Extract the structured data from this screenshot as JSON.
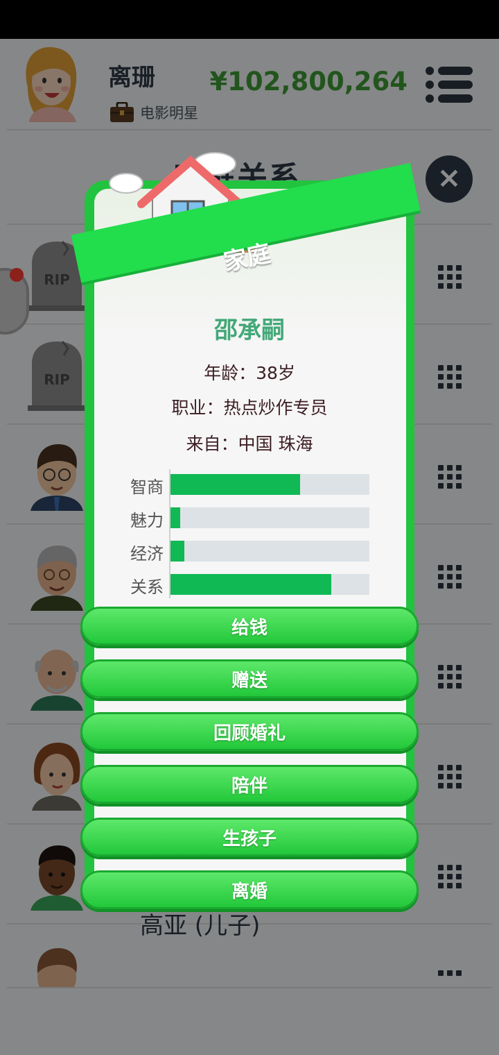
{
  "header": {
    "player_name": "离珊",
    "occupation": "电影明星",
    "money": "¥102,800,264"
  },
  "page": {
    "title": "家庭关系"
  },
  "relations": [
    {
      "type": "deceased",
      "tombstone_text": "RIP"
    },
    {
      "type": "deceased",
      "tombstone_text": "RIP"
    },
    {
      "type": "person"
    },
    {
      "type": "person"
    },
    {
      "type": "person"
    },
    {
      "type": "person"
    },
    {
      "type": "person"
    },
    {
      "type": "person",
      "name": "高亚 (儿子)"
    }
  ],
  "dialog": {
    "banner": "家庭",
    "name": "邵承嗣",
    "age": "年龄：38岁",
    "job": "职业：热点炒作专员",
    "origin": "来自：中国 珠海",
    "stats": [
      {
        "label": "智商",
        "value": 0.65
      },
      {
        "label": "魅力",
        "value": 0.05
      },
      {
        "label": "经济",
        "value": 0.07
      },
      {
        "label": "关系",
        "value": 0.81
      }
    ],
    "actions": [
      "给钱",
      "赠送",
      "回顾婚礼",
      "陪伴",
      "生孩子",
      "离婚"
    ]
  },
  "colors": {
    "money": "#3e9c35",
    "accent_green": "#22c33f",
    "stat_fill": "#10b954",
    "name_teal": "#43a878"
  }
}
